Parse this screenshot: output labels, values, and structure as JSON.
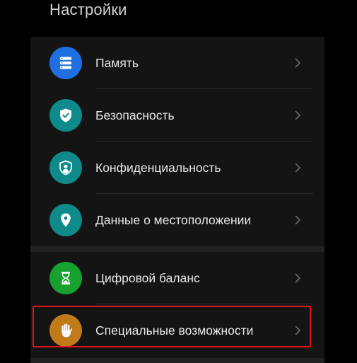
{
  "header": {
    "title": "Настройки"
  },
  "colors": {
    "memory": "#1f6fe0",
    "security": "#0e8a8a",
    "privacy": "#0e8a8a",
    "location": "#0e8a8a",
    "digital_balance": "#17a12e",
    "accessibility": "#c07a1a",
    "highlight": "#e0121a"
  },
  "settings": {
    "group1": [
      {
        "label": "Память",
        "icon": "storage-icon"
      },
      {
        "label": "Безопасность",
        "icon": "shield-check-icon"
      },
      {
        "label": "Конфиденциальность",
        "icon": "privacy-shield-user-icon"
      },
      {
        "label": "Данные о местоположении",
        "icon": "location-pin-icon"
      }
    ],
    "group2": [
      {
        "label": "Цифровой баланс",
        "icon": "hourglass-icon"
      },
      {
        "label": "Специальные возможности",
        "icon": "hand-icon"
      }
    ]
  }
}
